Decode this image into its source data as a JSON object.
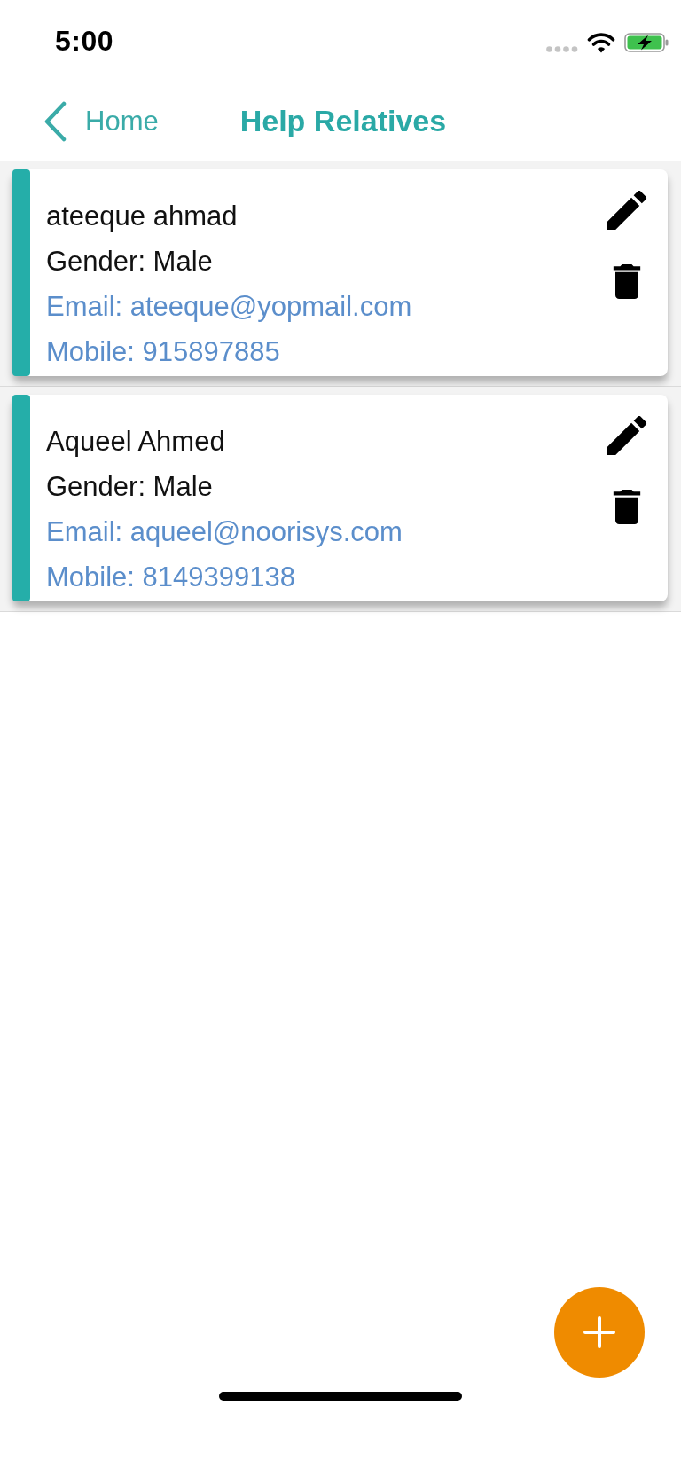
{
  "status_bar": {
    "time": "5:00"
  },
  "nav_bar": {
    "back_label": "Home",
    "title": "Help Relatives"
  },
  "relatives": [
    {
      "name": "ateeque ahmad",
      "gender": "Gender: Male",
      "email": "Email: ateeque@yopmail.com",
      "mobile": "Mobile: 915897885"
    },
    {
      "name": "Aqueel Ahmed",
      "gender": "Gender: Male",
      "email": "Email: aqueel@noorisys.com",
      "mobile": "Mobile: 8149399138"
    }
  ]
}
